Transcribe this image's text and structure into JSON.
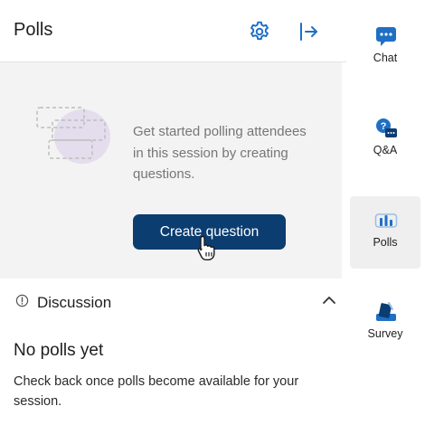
{
  "header": {
    "title": "Polls"
  },
  "empty_state": {
    "message": "Get started polling attendees in this session by creating questions.",
    "create_button_label": "Create question"
  },
  "discussion": {
    "title": "Discussion",
    "no_polls_title": "No polls yet",
    "no_polls_text": "Check back once polls become available for your session."
  },
  "rail": {
    "items": [
      {
        "label": "Chat",
        "icon": "chat-icon",
        "active": false
      },
      {
        "label": "Q&A",
        "icon": "qa-icon",
        "active": false
      },
      {
        "label": "Polls",
        "icon": "polls-icon",
        "active": true
      },
      {
        "label": "Survey",
        "icon": "survey-icon",
        "active": false
      }
    ]
  },
  "colors": {
    "primary_button": "#0b3d70",
    "accent_blue": "#1f6fc4",
    "empty_background": "#f3f3f3",
    "active_rail_bg": "#efefef"
  }
}
